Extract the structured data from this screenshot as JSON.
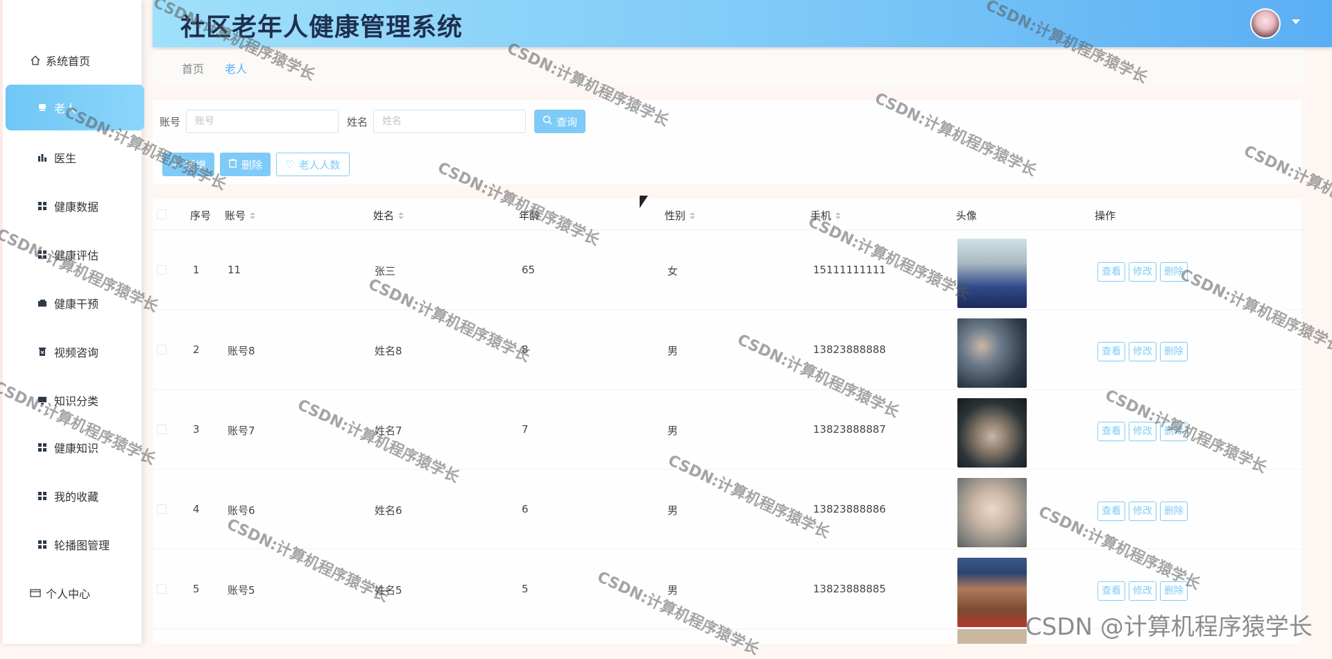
{
  "header": {
    "title": "社区老年人健康管理系统"
  },
  "sidebar": {
    "items": [
      {
        "label": "系统首页",
        "icon": "home-icon"
      },
      {
        "label": "老人",
        "icon": "user-icon",
        "active": true
      },
      {
        "label": "医生",
        "icon": "chart-icon"
      },
      {
        "label": "健康数据",
        "icon": "grid-icon"
      },
      {
        "label": "健康评估",
        "icon": "grid-icon"
      },
      {
        "label": "健康干预",
        "icon": "wallet-icon"
      },
      {
        "label": "视频咨询",
        "icon": "delete-icon"
      },
      {
        "label": "知识分类",
        "icon": "monitor-icon"
      },
      {
        "label": "健康知识",
        "icon": "grid-icon"
      },
      {
        "label": "我的收藏",
        "icon": "grid-icon"
      },
      {
        "label": "轮播图管理",
        "icon": "grid-icon"
      },
      {
        "label": "个人中心",
        "icon": "card-icon"
      }
    ]
  },
  "breadcrumb": [
    "首页",
    "老人"
  ],
  "search": {
    "account_label": "账号",
    "account_placeholder": "账号",
    "name_label": "姓名",
    "name_placeholder": "姓名",
    "query_label": "查询"
  },
  "actions": {
    "add": "新增",
    "delete": "删除",
    "count": "老人人数"
  },
  "table": {
    "columns": [
      "序号",
      "账号",
      "姓名",
      "年龄",
      "性别",
      "手机",
      "头像",
      "操作"
    ],
    "rows": [
      {
        "index": "1",
        "account": "11",
        "name": "张三",
        "age": "65",
        "gender": "女",
        "phone": "15111111111",
        "photo": "elderly man at laptop"
      },
      {
        "index": "2",
        "account": "账号8",
        "name": "姓名8",
        "age": "8",
        "gender": "男",
        "phone": "13823888888",
        "photo": "elderly couple figurines"
      },
      {
        "index": "3",
        "account": "账号7",
        "name": "姓名7",
        "age": "7",
        "gender": "男",
        "phone": "13823888887",
        "photo": "bearded old man with cap"
      },
      {
        "index": "4",
        "account": "账号6",
        "name": "姓名6",
        "age": "6",
        "gender": "男",
        "phone": "13823888886",
        "photo": "elderly woman"
      },
      {
        "index": "5",
        "account": "账号5",
        "name": "姓名5",
        "age": "5",
        "gender": "男",
        "phone": "13823888885",
        "photo": "elderly man with headscarf"
      }
    ],
    "row_ops": {
      "view": "查看",
      "edit": "修改",
      "delete": "删除"
    }
  },
  "watermark": "CSDN:计算机程序猿学长",
  "footer_watermark": "CSDN @计算机程序猿学长",
  "colors": {
    "accent": "#7ecbf7",
    "header_dark_text": "#1f2f4f"
  }
}
